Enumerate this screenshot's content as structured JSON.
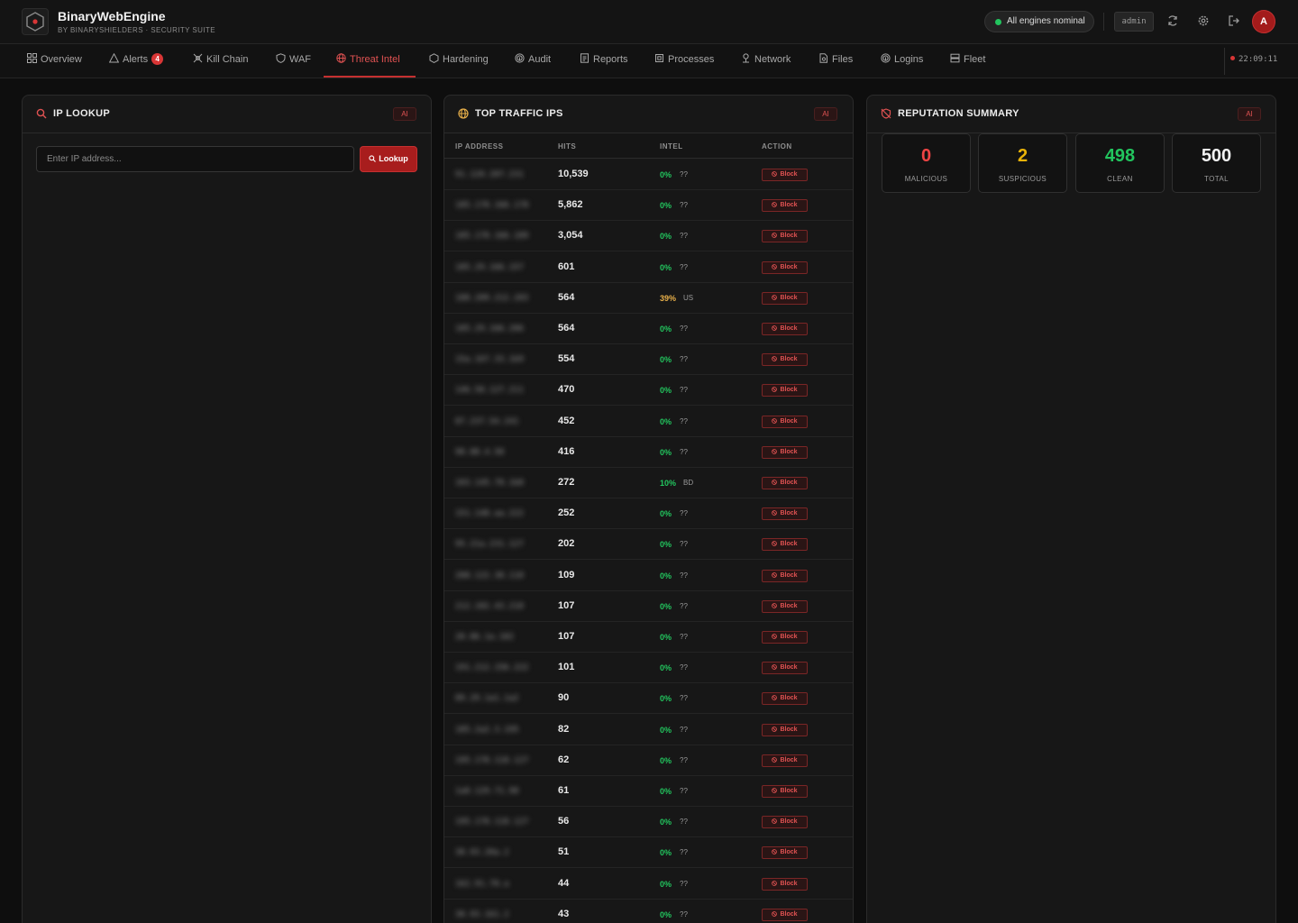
{
  "app": {
    "name": "BinaryWebEngine",
    "subtitle": "BY BINARYSHIELDERS · SECURITY SUITE",
    "status": "All engines nominal",
    "user": "admin",
    "avatar_initial": "A",
    "clock": "22:09:11",
    "accent": "#c53030"
  },
  "nav": {
    "tabs": [
      {
        "label": "Overview",
        "icon": "grid-icon"
      },
      {
        "label": "Alerts",
        "icon": "warning-icon",
        "badge": "4"
      },
      {
        "label": "Kill Chain",
        "icon": "crosshair-icon"
      },
      {
        "label": "WAF",
        "icon": "shield-icon"
      },
      {
        "label": "Threat Intel",
        "icon": "globe-icon",
        "active": true
      },
      {
        "label": "Hardening",
        "icon": "hexagon-icon"
      },
      {
        "label": "Audit",
        "icon": "fingerprint-icon"
      },
      {
        "label": "Reports",
        "icon": "report-icon"
      },
      {
        "label": "Processes",
        "icon": "cpu-icon"
      },
      {
        "label": "Network",
        "icon": "network-icon"
      },
      {
        "label": "Files",
        "icon": "file-icon"
      },
      {
        "label": "Logins",
        "icon": "fingerprint-icon"
      },
      {
        "label": "Fleet",
        "icon": "server-icon"
      }
    ]
  },
  "ip_lookup": {
    "title": "IP LOOKUP",
    "ai": "AI",
    "placeholder": "Enter IP address...",
    "button": "Lookup"
  },
  "traffic": {
    "title": "TOP TRAFFIC IPS",
    "ai": "AI",
    "columns": [
      "IP ADDRESS",
      "HITS",
      "INTEL",
      "ACTION"
    ],
    "action_label": "Block",
    "rows": [
      {
        "ip": "91.120.207.231",
        "hits": "10,539",
        "pct": "0%",
        "cc": "??"
      },
      {
        "ip": "185.178.166.178",
        "hits": "5,862",
        "pct": "0%",
        "cc": "??"
      },
      {
        "ip": "185.178.166.189",
        "hits": "3,054",
        "pct": "0%",
        "cc": "??"
      },
      {
        "ip": "185.29.166.157",
        "hits": "601",
        "pct": "0%",
        "cc": "??"
      },
      {
        "ip": "188.209.212.203",
        "hits": "564",
        "pct": "39%",
        "cc": "US"
      },
      {
        "ip": "185.29.166.206",
        "hits": "564",
        "pct": "0%",
        "cc": "??"
      },
      {
        "ip": "15a.167.33.1b9",
        "hits": "554",
        "pct": "0%",
        "cc": "??"
      },
      {
        "ip": "146.58.127.211",
        "hits": "470",
        "pct": "0%",
        "cc": "??"
      },
      {
        "ip": "87.237.54.241",
        "hits": "452",
        "pct": "0%",
        "cc": "??"
      },
      {
        "ip": "98.88.4.58",
        "hits": "416",
        "pct": "0%",
        "cc": "??"
      },
      {
        "ip": "103.145.78.1b8",
        "hits": "272",
        "pct": "10%",
        "cc": "BD"
      },
      {
        "ip": "151.148.aa.222",
        "hits": "252",
        "pct": "0%",
        "cc": "??"
      },
      {
        "ip": "95.21a.231.127",
        "hits": "202",
        "pct": "0%",
        "cc": "??"
      },
      {
        "ip": "208.122.38.118",
        "hits": "109",
        "pct": "0%",
        "cc": "??"
      },
      {
        "ip": "212.182.43.218",
        "hits": "107",
        "pct": "0%",
        "cc": "??"
      },
      {
        "ip": "20.86.1a.182",
        "hits": "107",
        "pct": "0%",
        "cc": "??"
      },
      {
        "ip": "191.212.156.222",
        "hits": "101",
        "pct": "0%",
        "cc": "??"
      },
      {
        "ip": "89.29.1a1.1a2",
        "hits": "90",
        "pct": "0%",
        "cc": "??"
      },
      {
        "ip": "185.2a2.3.195",
        "hits": "82",
        "pct": "0%",
        "cc": "??"
      },
      {
        "ip": "195.178.118.127",
        "hits": "62",
        "pct": "0%",
        "cc": "??"
      },
      {
        "ip": "1a8.129.71.98",
        "hits": "61",
        "pct": "0%",
        "cc": "??"
      },
      {
        "ip": "195.178.118.127",
        "hits": "56",
        "pct": "0%",
        "cc": "??"
      },
      {
        "ip": "38.93.20a.2",
        "hits": "51",
        "pct": "0%",
        "cc": "??"
      },
      {
        "ip": "162.91.78.a",
        "hits": "44",
        "pct": "0%",
        "cc": "??"
      },
      {
        "ip": "38.93.161.2",
        "hits": "43",
        "pct": "0%",
        "cc": "??"
      }
    ]
  },
  "reputation": {
    "title": "REPUTATION SUMMARY",
    "ai": "AI",
    "stats": [
      {
        "value": "0",
        "label": "MALICIOUS",
        "color": "#ef4444"
      },
      {
        "value": "2",
        "label": "SUSPICIOUS",
        "color": "#eab308"
      },
      {
        "value": "498",
        "label": "CLEAN",
        "color": "#22c55e"
      },
      {
        "value": "500",
        "label": "TOTAL",
        "color": "#f2f2f2"
      }
    ]
  }
}
